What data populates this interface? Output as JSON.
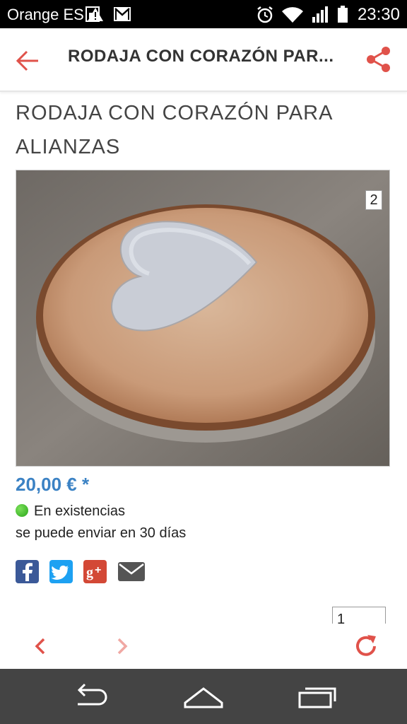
{
  "status_bar": {
    "carrier": "Orange ES",
    "time": "23:30",
    "icons": [
      "sim-icon",
      "warning-icon",
      "gmail-icon",
      "alarm-icon",
      "wifi-icon",
      "signal-icon",
      "battery-icon"
    ]
  },
  "app_bar": {
    "title": "RODAJA CON CORAZÓN PAR...",
    "back_icon": "arrow-left-icon",
    "share_icon": "share-icon",
    "accent": "#e0524a"
  },
  "product": {
    "title": "RODAJA CON CORAZÓN PARA ALIANZAS",
    "image_count": "2",
    "price": "20,00 € *",
    "stock": "En existencias",
    "shipping": "se puede enviar en 30 días",
    "price_color": "#3b82c4",
    "quantity": "1"
  },
  "social": [
    "facebook-icon",
    "twitter-icon",
    "google-plus-icon",
    "email-icon"
  ],
  "toolbar": [
    "prev-icon",
    "next-icon",
    "refresh-icon"
  ],
  "nav_bar": [
    "back-icon",
    "home-icon",
    "recents-icon"
  ]
}
